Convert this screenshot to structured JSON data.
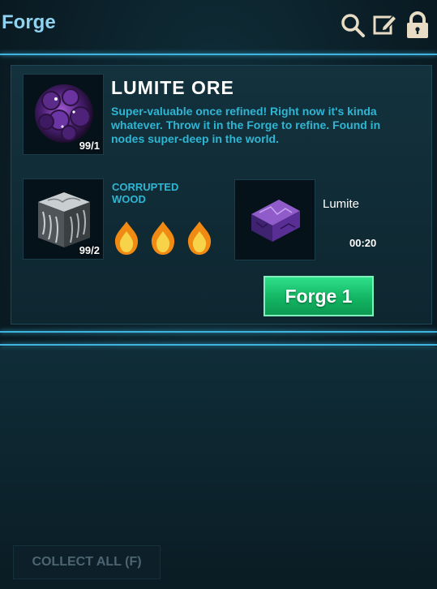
{
  "header": {
    "title": "Forge"
  },
  "item": {
    "name": "LUMITE ORE",
    "description": "Super-valuable once refined! Right now it's kinda whatever. Throw it in the Forge to refine. Found in nodes super-deep in the world.",
    "count": "99/1"
  },
  "fuel": {
    "label": "CORRUPTED WOOD",
    "count": "99/2",
    "flames": 3
  },
  "result": {
    "name": "Lumite",
    "time": "00:20"
  },
  "actions": {
    "forge_label": "Forge 1",
    "collect_label": "COLLECT ALL (F)"
  },
  "colors": {
    "accent": "#3fb4df",
    "text_cyan": "#2fb6d4",
    "forge_green": "#13b563"
  }
}
